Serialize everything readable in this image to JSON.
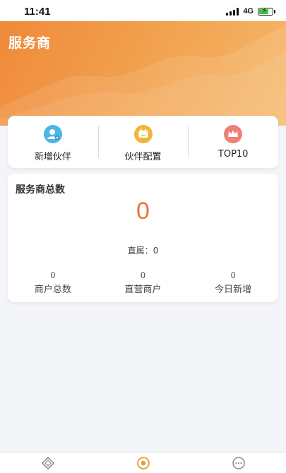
{
  "status_bar": {
    "time": "11:41",
    "network": "4G",
    "icons": [
      "signal-icon",
      "battery-charging-icon"
    ]
  },
  "header": {
    "title": "服务商",
    "background_colors": [
      "#ef8a3a",
      "#f5b86a"
    ]
  },
  "quick_actions": [
    {
      "label": "新增伙伴",
      "icon": "add-partner-icon",
      "color": "#4fb4e6"
    },
    {
      "label": "伙伴配置",
      "icon": "partner-config-icon",
      "color": "#f0b53a"
    },
    {
      "label": "TOP10",
      "icon": "crown-icon",
      "color": "#ef7f79"
    }
  ],
  "stats": {
    "title": "服务商总数",
    "total": "0",
    "direct_label": "直属：",
    "direct_value": "0",
    "items": [
      {
        "value": "0",
        "label": "商户总数"
      },
      {
        "value": "0",
        "label": "直营商户"
      },
      {
        "value": "0",
        "label": "今日新增"
      }
    ],
    "accent_color": "#e8773a"
  },
  "tabbar": {
    "tabs": [
      {
        "icon": "diamond-icon",
        "active": false
      },
      {
        "icon": "eye-icon",
        "active": true
      },
      {
        "icon": "chat-icon",
        "active": false
      }
    ],
    "active_color": "#e89a2e"
  }
}
